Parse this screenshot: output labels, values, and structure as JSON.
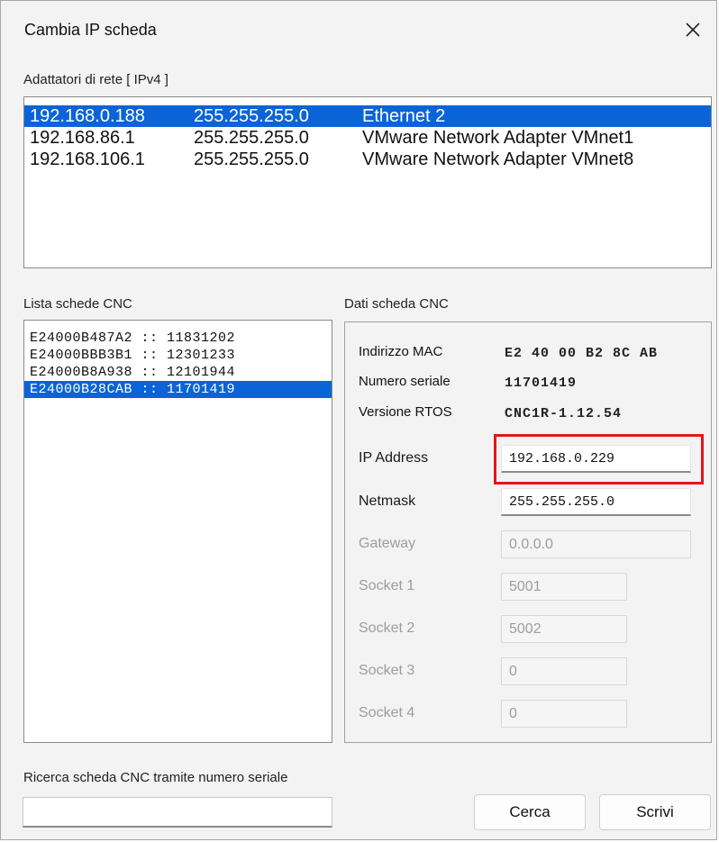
{
  "window": {
    "title": "Cambia IP scheda"
  },
  "adapters": {
    "label": "Adattatori di rete [ IPv4 ]",
    "rows": [
      {
        "ip": "192.168.0.188",
        "mask": "255.255.255.0",
        "name": "Ethernet 2",
        "selected": true
      },
      {
        "ip": "192.168.86.1",
        "mask": "255.255.255.0",
        "name": "VMware Network Adapter VMnet1",
        "selected": false
      },
      {
        "ip": "192.168.106.1",
        "mask": "255.255.255.0",
        "name": "VMware Network Adapter VMnet8",
        "selected": false
      }
    ]
  },
  "cnc_list": {
    "label": "Lista schede CNC",
    "rows": [
      {
        "text": "E24000B487A2 :: 11831202",
        "selected": false
      },
      {
        "text": "E24000BBB3B1 :: 12301233",
        "selected": false
      },
      {
        "text": "E24000B8A938 :: 12101944",
        "selected": false
      },
      {
        "text": "E24000B28CAB :: 11701419",
        "selected": true
      }
    ]
  },
  "details": {
    "label": "Dati scheda CNC",
    "mac_label": "Indirizzo MAC",
    "mac_value": "E2 40 00 B2 8C AB",
    "serial_label": "Numero seriale",
    "serial_value": "11701419",
    "rtos_label": "Versione RTOS",
    "rtos_value": "CNC1R-1.12.54",
    "ip_label": "IP Address",
    "ip_value": "192.168.0.229",
    "netmask_label": "Netmask",
    "netmask_value": "255.255.255.0",
    "gateway_label": "Gateway",
    "gateway_value": "0.0.0.0",
    "socket1_label": "Socket 1",
    "socket1_value": "5001",
    "socket2_label": "Socket 2",
    "socket2_value": "5002",
    "socket3_label": "Socket 3",
    "socket3_value": "0",
    "socket4_label": "Socket 4",
    "socket4_value": "0"
  },
  "search": {
    "label": "Ricerca scheda CNC tramite numero seriale",
    "value": ""
  },
  "buttons": {
    "search": "Cerca",
    "write": "Scrivi"
  },
  "colors": {
    "selection": "#0a64d8",
    "highlight_box": "#e2161d"
  }
}
